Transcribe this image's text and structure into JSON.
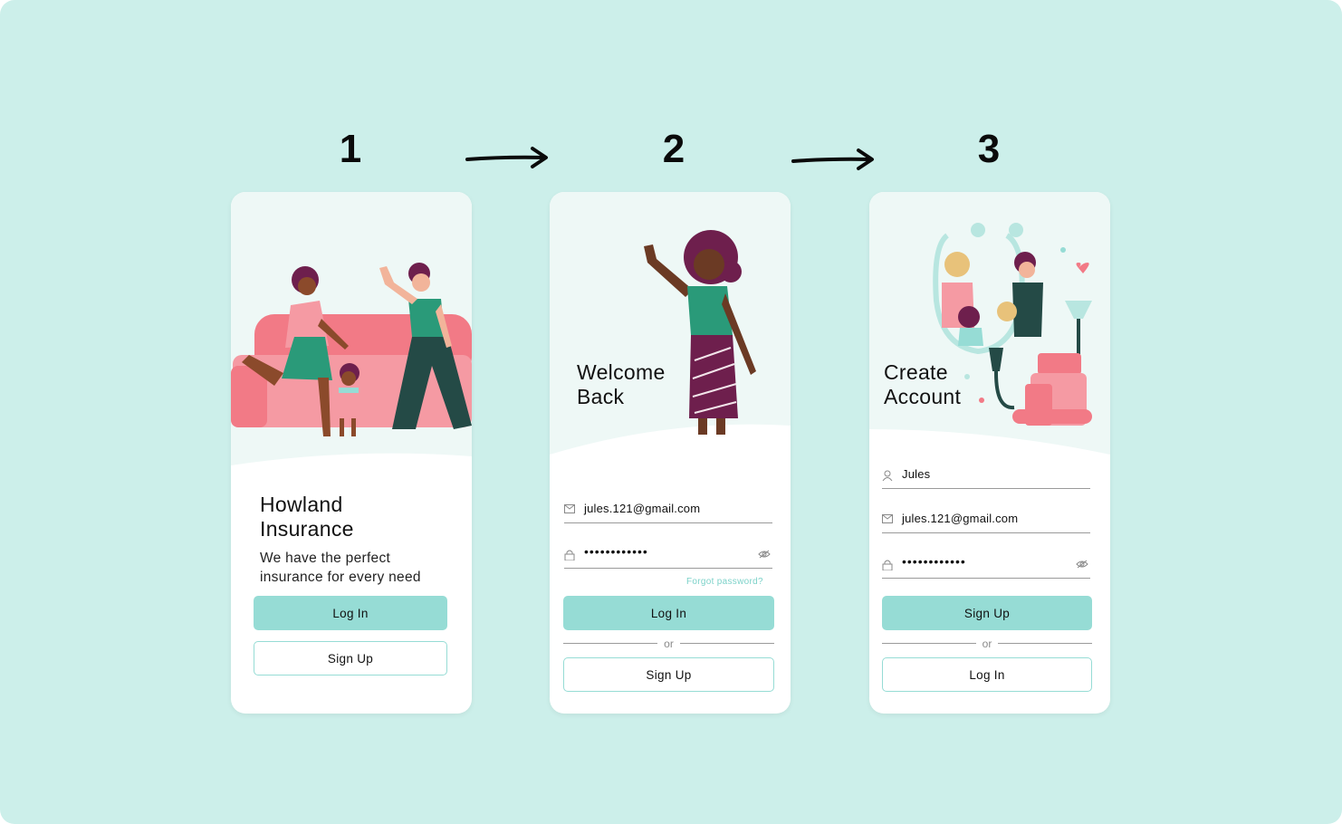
{
  "steps": [
    "1",
    "2",
    "3"
  ],
  "screen1": {
    "title_line1": "Howland",
    "title_line2": "Insurance",
    "tagline_line1": "We have the perfect",
    "tagline_line2": "insurance for every need",
    "login_label": "Log In",
    "signup_label": "Sign Up"
  },
  "screen2": {
    "title_line1": "Welcome",
    "title_line2": "Back",
    "email_value": "jules.121@gmail.com",
    "password_value": "••••••••••••",
    "forgot_label": "Forgot password?",
    "login_label": "Log In",
    "or_label": "or",
    "signup_label": "Sign Up"
  },
  "screen3": {
    "title_line1": "Create",
    "title_line2": "Account",
    "name_value": "Jules",
    "email_value": "jules.121@gmail.com",
    "password_value": "••••••••••••",
    "signup_label": "Sign Up",
    "or_label": "or",
    "login_label": "Log In"
  },
  "icons": {
    "email": "mail-icon",
    "password": "lock-icon",
    "name": "person-icon",
    "visibility": "eye-off-icon"
  },
  "colors": {
    "background": "#ccefea",
    "accent": "#96dcd5",
    "link": "#7cd2c9",
    "sofa": "#f27a86",
    "green": "#2a9a79",
    "plum": "#6e1f4d"
  }
}
